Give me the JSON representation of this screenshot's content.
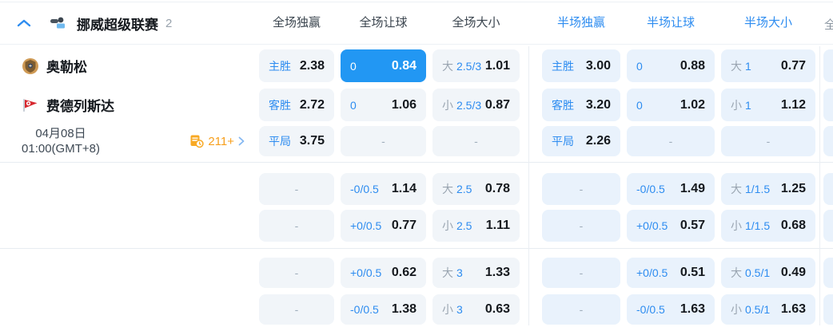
{
  "colors": {
    "accent_blue": "#2d8cf0",
    "selected_cell_bg": "#2297f3",
    "full_period_cell_bg": "#f1f5f9",
    "half_period_cell_bg": "#e9f2fc",
    "orange": "#f79f1c"
  },
  "league_header": {
    "title": "挪威超级联赛",
    "count": "2",
    "columns": [
      {
        "label": "全场独赢",
        "period": "full"
      },
      {
        "label": "全场让球",
        "period": "full"
      },
      {
        "label": "全场大小",
        "period": "full"
      },
      {
        "label": "半场独赢",
        "period": "half"
      },
      {
        "label": "半场让球",
        "period": "half"
      },
      {
        "label": "半场大小",
        "period": "half"
      }
    ],
    "clipped_next_column": "全"
  },
  "match_info": {
    "home_team": "奥勒松",
    "away_team": "费德列斯达",
    "date": "04月08日",
    "time": "01:00(GMT+8)",
    "more_markets": "211+"
  },
  "empty_cell_text": "-",
  "odds_rows": [
    {
      "cells": [
        {
          "label": "主胜",
          "value": "2.38"
        },
        {
          "label": "0",
          "value": "0.84",
          "selected": true
        },
        {
          "prefix": "大",
          "label": "2.5/3",
          "value": "1.01"
        },
        {
          "label": "主胜",
          "value": "3.00"
        },
        {
          "label": "0",
          "value": "0.88"
        },
        {
          "prefix": "大",
          "label": "1",
          "value": "0.77"
        }
      ]
    },
    {
      "cells": [
        {
          "label": "客胜",
          "value": "2.72"
        },
        {
          "label": "0",
          "value": "1.06"
        },
        {
          "prefix": "小",
          "label": "2.5/3",
          "value": "0.87"
        },
        {
          "label": "客胜",
          "value": "3.20"
        },
        {
          "label": "0",
          "value": "1.02"
        },
        {
          "prefix": "小",
          "label": "1",
          "value": "1.12"
        }
      ]
    },
    {
      "cells": [
        {
          "label": "平局",
          "value": "3.75"
        },
        {
          "empty": true
        },
        {
          "empty": true
        },
        {
          "label": "平局",
          "value": "2.26"
        },
        {
          "empty": true
        },
        {
          "empty": true
        }
      ]
    },
    {
      "cells": [
        {
          "empty": true
        },
        {
          "label": "-0/0.5",
          "value": "1.14"
        },
        {
          "prefix": "大",
          "label": "2.5",
          "value": "0.78"
        },
        {
          "empty": true
        },
        {
          "label": "-0/0.5",
          "value": "1.49"
        },
        {
          "prefix": "大",
          "label": "1/1.5",
          "value": "1.25"
        }
      ]
    },
    {
      "cells": [
        {
          "empty": true
        },
        {
          "label": "+0/0.5",
          "value": "0.77"
        },
        {
          "prefix": "小",
          "label": "2.5",
          "value": "1.11"
        },
        {
          "empty": true
        },
        {
          "label": "+0/0.5",
          "value": "0.57"
        },
        {
          "prefix": "小",
          "label": "1/1.5",
          "value": "0.68"
        }
      ]
    },
    {
      "cells": [
        {
          "empty": true
        },
        {
          "label": "+0/0.5",
          "value": "0.62"
        },
        {
          "prefix": "大",
          "label": "3",
          "value": "1.33"
        },
        {
          "empty": true
        },
        {
          "label": "+0/0.5",
          "value": "0.51"
        },
        {
          "prefix": "大",
          "label": "0.5/1",
          "value": "0.49"
        }
      ]
    },
    {
      "cells": [
        {
          "empty": true
        },
        {
          "label": "-0/0.5",
          "value": "1.38"
        },
        {
          "prefix": "小",
          "label": "3",
          "value": "0.63"
        },
        {
          "empty": true
        },
        {
          "label": "-0/0.5",
          "value": "1.63"
        },
        {
          "prefix": "小",
          "label": "0.5/1",
          "value": "1.63"
        }
      ]
    }
  ]
}
